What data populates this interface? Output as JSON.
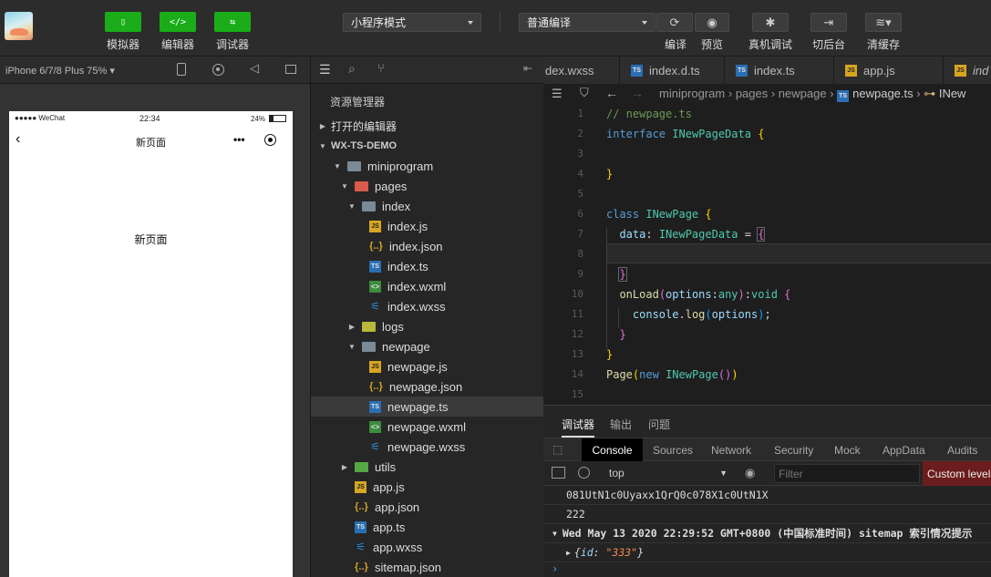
{
  "toolbar": {
    "buttons": [
      {
        "label": "模拟器",
        "glyph": "▯"
      },
      {
        "label": "编辑器",
        "glyph": "</>"
      },
      {
        "label": "调试器",
        "glyph": "⇆"
      }
    ],
    "mode_select": "小程序模式",
    "compile_select": "普通编译",
    "actions": [
      {
        "label": "编译",
        "icon": "refresh-icon"
      },
      {
        "label": "预览",
        "icon": "eye-icon"
      },
      {
        "label": "真机调试",
        "icon": "bug-icon"
      },
      {
        "label": "切后台",
        "icon": "switch-icon"
      },
      {
        "label": "清缓存",
        "icon": "layers-icon"
      }
    ]
  },
  "simulator": {
    "device": "iPhone 6/7/8 Plus 75%",
    "statusbar": {
      "carrier": "●●●●● WeChat",
      "time": "22:34",
      "battery": "24%"
    },
    "nav_title": "新页面",
    "nav_more": "•••",
    "page_text": "新页面"
  },
  "explorer": {
    "title": "资源管理器",
    "open_editors": "打开的编辑器",
    "project": "WX-TS-DEMO",
    "tree": [
      {
        "label": "miniprogram",
        "type": "folder",
        "indent": 1,
        "open": true
      },
      {
        "label": "pages",
        "type": "folder-pages",
        "indent": 2,
        "open": true
      },
      {
        "label": "index",
        "type": "folder",
        "indent": 3,
        "open": true
      },
      {
        "label": "index.js",
        "type": "js",
        "indent": 4
      },
      {
        "label": "index.json",
        "type": "json",
        "indent": 4
      },
      {
        "label": "index.ts",
        "type": "ts",
        "indent": 4
      },
      {
        "label": "index.wxml",
        "type": "wxml",
        "indent": 4
      },
      {
        "label": "index.wxss",
        "type": "wxss",
        "indent": 4
      },
      {
        "label": "logs",
        "type": "folder-logs",
        "indent": 3,
        "open": false
      },
      {
        "label": "newpage",
        "type": "folder",
        "indent": 3,
        "open": true
      },
      {
        "label": "newpage.js",
        "type": "js",
        "indent": 4
      },
      {
        "label": "newpage.json",
        "type": "json",
        "indent": 4
      },
      {
        "label": "newpage.ts",
        "type": "ts",
        "indent": 4,
        "selected": true
      },
      {
        "label": "newpage.wxml",
        "type": "wxml",
        "indent": 4
      },
      {
        "label": "newpage.wxss",
        "type": "wxss",
        "indent": 4
      },
      {
        "label": "utils",
        "type": "folder-utils",
        "indent": 2,
        "open": false
      },
      {
        "label": "app.js",
        "type": "js",
        "indent": 2
      },
      {
        "label": "app.json",
        "type": "json",
        "indent": 2
      },
      {
        "label": "app.ts",
        "type": "ts",
        "indent": 2
      },
      {
        "label": "app.wxss",
        "type": "wxss",
        "indent": 2
      },
      {
        "label": "sitemap.json",
        "type": "json",
        "indent": 2
      }
    ]
  },
  "editor": {
    "tabs": [
      {
        "label": "dex.wxss",
        "icon": ""
      },
      {
        "label": "index.d.ts",
        "icon": "ts"
      },
      {
        "label": "index.ts",
        "icon": "ts"
      },
      {
        "label": "app.js",
        "icon": "js"
      },
      {
        "label": "ind",
        "icon": "js"
      }
    ],
    "breadcrumb": [
      "miniprogram",
      "pages",
      "newpage",
      "newpage.ts",
      "INew"
    ],
    "line_numbers": [
      "1",
      "2",
      "3",
      "4",
      "5",
      "6",
      "7",
      "8",
      "9",
      "10",
      "11",
      "12",
      "13",
      "14",
      "15"
    ]
  },
  "debugger": {
    "tabs": [
      "调试器",
      "输出",
      "问题"
    ],
    "console_tabs": [
      "Console",
      "Sources",
      "Network",
      "Security",
      "Mock",
      "AppData",
      "Audits"
    ],
    "context": "top",
    "filter_placeholder": "Filter",
    "levels": "Custom levels",
    "output": [
      "081UtN1c0Uyaxx1QrQ0c078X1c0UtN1X",
      "222",
      "Wed May 13 2020 22:29:52 GMT+0800 (中国标准时间) sitemap 索引情况提示",
      "{id: \"333\"}"
    ]
  },
  "colors": {
    "accent_green": "#1aad19",
    "custom_levels_bg": "#6b1c1c"
  }
}
